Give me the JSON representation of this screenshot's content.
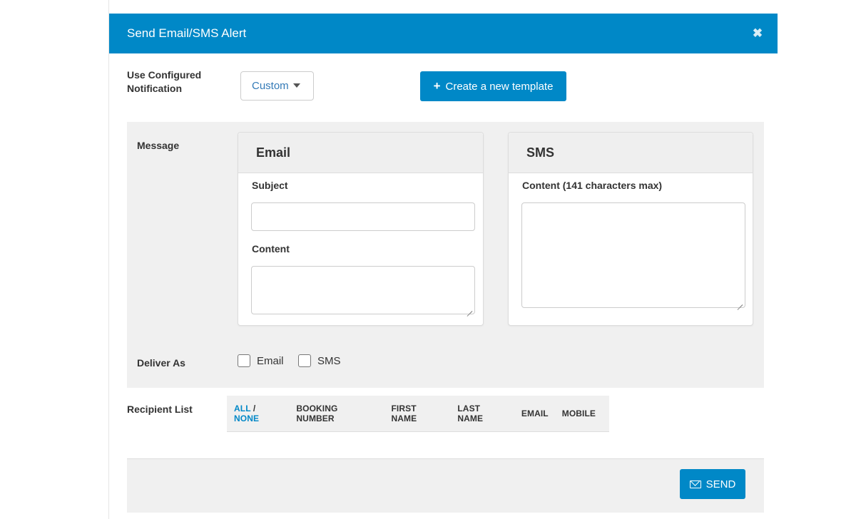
{
  "modal": {
    "title": "Send Email/SMS Alert",
    "close_icon": "close-icon"
  },
  "config": {
    "label": "Use Configured Notification",
    "dropdown_value": "Custom",
    "create_button": "Create a new template"
  },
  "message": {
    "label": "Message",
    "email_panel": {
      "title": "Email",
      "subject_label": "Subject",
      "subject_value": "",
      "content_label": "Content",
      "content_value": ""
    },
    "sms_panel": {
      "title": "SMS",
      "content_label": "Content (141 characters max)",
      "content_value": ""
    }
  },
  "deliver": {
    "label": "Deliver As",
    "options": [
      {
        "label": "Email",
        "checked": false
      },
      {
        "label": "SMS",
        "checked": false
      }
    ]
  },
  "recipients": {
    "label": "Recipient List",
    "select_all": "ALL",
    "separator": "/",
    "select_none": "NONE",
    "columns": [
      "BOOKING NUMBER",
      "FIRST NAME",
      "LAST NAME",
      "EMAIL",
      "MOBILE"
    ]
  },
  "footer": {
    "send_button": "SEND"
  },
  "colors": {
    "accent": "#0088c7",
    "section_bg": "#f0f0f0"
  }
}
